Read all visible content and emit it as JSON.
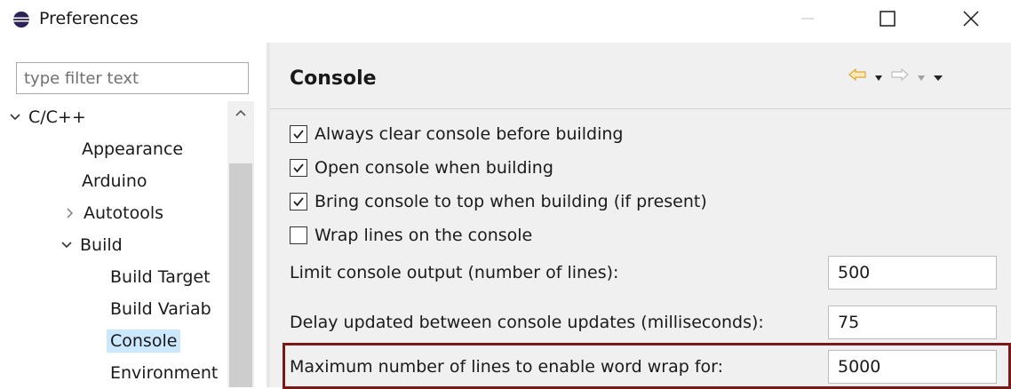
{
  "window": {
    "title": "Preferences",
    "icon": "eclipse-icon",
    "controls": [
      "minimize-icon",
      "maximize-icon",
      "close-icon"
    ]
  },
  "filter": {
    "placeholder": "type filter text"
  },
  "tree": {
    "items": [
      {
        "label": "C/C++",
        "expander": "expanded"
      },
      {
        "label": "Appearance"
      },
      {
        "label": "Arduino"
      },
      {
        "label": "Autotools",
        "expander": "collapsed"
      },
      {
        "label": "Build",
        "expander": "expanded"
      },
      {
        "label": "Build Target"
      },
      {
        "label": "Build Variab"
      },
      {
        "label": "Console",
        "selected": true
      },
      {
        "label": "Environment"
      }
    ]
  },
  "page": {
    "title": "Console",
    "checkboxes": [
      {
        "label": "Always clear console before building",
        "checked": true
      },
      {
        "label": "Open console when building",
        "checked": true
      },
      {
        "label": "Bring console to top when building (if present)",
        "checked": true
      },
      {
        "label": "Wrap lines on the console",
        "checked": false
      }
    ],
    "fields": [
      {
        "label": "Limit console output (number of lines):",
        "value": "500"
      },
      {
        "label": "Delay updated between console updates (milliseconds):",
        "value": "75"
      },
      {
        "label": "Maximum number of lines to enable word wrap for:",
        "value": "5000"
      }
    ]
  },
  "colors": {
    "selection": "#cce8ff",
    "highlight_border": "#7a1818",
    "back_arrow": "#e8c060"
  }
}
